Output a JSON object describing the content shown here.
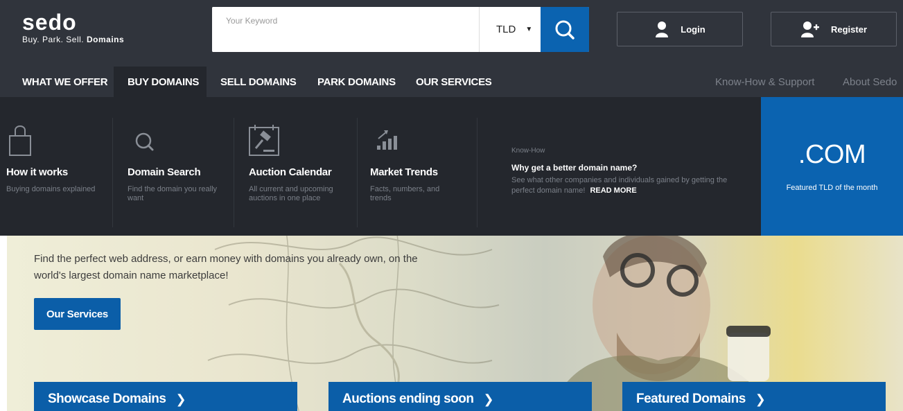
{
  "brand": {
    "name": "sedo",
    "tagline_plain": "Buy. Park. Sell.",
    "tagline_bold": "Domains"
  },
  "search": {
    "placeholder": "Your Keyword",
    "tld_label": "TLD",
    "button_icon": "search-icon"
  },
  "auth": {
    "login_label": "Login",
    "register_label": "Register"
  },
  "nav": {
    "items": [
      "WHAT WE OFFER",
      "BUY DOMAINS",
      "SELL DOMAINS",
      "PARK DOMAINS",
      "OUR SERVICES"
    ],
    "active": "BUY DOMAINS",
    "right": [
      "Know-How & Support",
      "About Sedo"
    ]
  },
  "mega_menu": {
    "columns": [
      {
        "title": "How it works",
        "description": "Buying domains explained",
        "icon": "shopping-bag-icon"
      },
      {
        "title": "Domain Search",
        "description": "Find the domain you really want",
        "icon": "magnifier-icon"
      },
      {
        "title": "Auction Calendar",
        "description": "All current and upcoming auctions in one place",
        "icon": "auction-gavel-icon"
      },
      {
        "title": "Market Trends",
        "description": "Facts, numbers, and trends",
        "icon": "trend-chart-icon"
      }
    ],
    "know_how": {
      "label": "Know-How",
      "title": "Why get a better domain name?",
      "description": "See what other companies and individuals gained by getting the perfect domain name!",
      "link": "READ MORE"
    },
    "featured_tld": {
      "tld": ".COM",
      "caption": "Featured TLD of the month"
    }
  },
  "hero": {
    "text": "Find the perfect web address, or earn money with domains you already own, on the world's largest domain name marketplace!",
    "cta": "Our Services",
    "tiles": [
      "Showcase Domains",
      "Auctions ending soon",
      "Featured Domains"
    ]
  },
  "colors": {
    "header_bg": "#30343c",
    "menu_bg": "#24272d",
    "accent_blue": "#0b63b0"
  }
}
